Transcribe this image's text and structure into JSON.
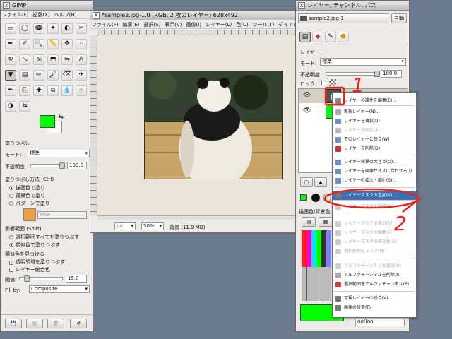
{
  "toolbox": {
    "title": "GIMP",
    "menu": [
      "ファイル(F)",
      "拡張(X)",
      "ヘルプ(H)"
    ],
    "tools_icons": [
      "rect-select-icon",
      "ellipse-select-icon",
      "free-select-icon",
      "fuzzy-select-icon",
      "color-select-icon",
      "scissors-icon",
      "paths-icon",
      "color-picker-icon",
      "zoom-icon",
      "measure-icon",
      "move-icon",
      "crop-icon",
      "rotate-icon",
      "scale-icon",
      "shear-icon",
      "perspective-icon",
      "flip-icon",
      "text-icon",
      "bucket-fill-icon",
      "blend-icon",
      "pencil-icon",
      "paintbrush-icon",
      "eraser-icon",
      "airbrush-icon",
      "ink-icon",
      "clone-icon",
      "heal-icon",
      "perspective-clone-icon",
      "blur-icon",
      "smudge-icon",
      "dodge-burn-icon",
      "color-swap-icon"
    ],
    "fg_color": "#00ff00",
    "bg_color": "#ffffff",
    "options_title": "塗りつぶし",
    "mode_label": "モード:",
    "mode_value": "標準",
    "opacity_label": "不透明度",
    "opacity_value": "100.0",
    "fill_type_label": "塗りつぶし方法 (Ctrl)",
    "fill_types": [
      "描画色で塗り",
      "背景色で塗り",
      "パターンで塗り"
    ],
    "pattern_name": "Pine",
    "affected_label": "影響範囲 (Shift)",
    "affected": [
      "選択範囲すべてを塗りつぶす",
      "類似色で塗りつぶす"
    ],
    "similar_label": "類似色を見つける",
    "transparent_label": "透明領域を塗りつぶす",
    "merged_label": "レイヤー統合色",
    "threshold_label": "閾値:",
    "threshold_value": "15.0",
    "fillby_label": "Fill by:",
    "fillby_value": "Composite"
  },
  "image_window": {
    "title": "*sample2.jpg-1.0 (RGB, 2 枚のレイヤー) 628x492",
    "menu": [
      "ファイル(F)",
      "編集(E)",
      "選択(S)",
      "表示(V)",
      "画像(I)",
      "レイヤー(L)",
      "色(C)",
      "ツール(T)",
      "ダイアロ"
    ],
    "unit": "px",
    "zoom": "50%",
    "status": "背景 (11.9 MB)"
  },
  "layers_window": {
    "title": "レイヤー, チャンネル, パス",
    "image_name": "sample2.jpg-1",
    "auto_label": "自動",
    "tab_label": "レイヤー",
    "mode_label": "モード:",
    "mode_value": "標準",
    "opacity_label": "不透明度",
    "opacity_value": "100.0",
    "lock_label": "ロック:",
    "palette_label": "描画色/背景色",
    "hex_value": "00ff00"
  },
  "context_menu": {
    "items": [
      {
        "label": "レイヤーの属性を編集(E)...",
        "disabled": false,
        "icon": "edit-icon"
      },
      {
        "label": "新規レイヤー(N)...",
        "disabled": false,
        "icon": "new-layer-icon"
      },
      {
        "label": "レイヤーを複製(U)",
        "disabled": false,
        "icon": "duplicate-icon"
      },
      {
        "label": "レイヤーを固定(A)",
        "disabled": true,
        "icon": "anchor-icon"
      },
      {
        "label": "下のレイヤーと統合(W)",
        "disabled": false,
        "icon": "merge-down-icon"
      },
      {
        "label": "レイヤーを削除(D)",
        "disabled": false,
        "icon": "delete-icon"
      },
      {
        "label": "レイヤー境界の大きさ(O)...",
        "disabled": false,
        "icon": "boundary-icon"
      },
      {
        "label": "レイヤーを画像サイズに合わせる(I)",
        "disabled": false,
        "icon": "fit-icon"
      },
      {
        "label": "レイヤーの拡大・縮小(S)...",
        "disabled": false,
        "icon": "scale-icon"
      },
      {
        "label": "レイヤーマスクの追加(Y)...",
        "disabled": false,
        "highlight": true,
        "icon": "mask-icon"
      },
      {
        "label": "レイヤーマスクを削除(E)",
        "disabled": true,
        "icon": "mask-delete-icon"
      },
      {
        "label": "レイヤーマスクの表示(S)",
        "disabled": true,
        "icon": "mask-show-icon"
      },
      {
        "label": "レイヤーマスクの編集(E)",
        "disabled": true,
        "icon": "mask-edit-icon"
      },
      {
        "label": "レイヤーマスクの無効化(D)",
        "disabled": true,
        "icon": "mask-disable-icon"
      },
      {
        "label": "選択範囲をマスク(M)",
        "disabled": true,
        "icon": "mask-select-icon"
      },
      {
        "label": "アルファチャンネルを追加(H)",
        "disabled": true,
        "icon": "alpha-add-icon"
      },
      {
        "label": "アルファチャンネルを削除(R)",
        "disabled": false,
        "icon": "alpha-remove-icon"
      },
      {
        "label": "選択範囲をアルファチャンネル(P)",
        "disabled": false,
        "icon": "alpha-select-icon"
      },
      {
        "label": "可視レイヤーの統合(V)...",
        "disabled": false,
        "icon": "merge-visible-icon"
      },
      {
        "label": "画像の統合(F)",
        "disabled": false,
        "icon": "flatten-icon"
      }
    ]
  },
  "annotations": {
    "one": "1",
    "two": "2"
  },
  "colors": {
    "annotation_red": "#e8241c",
    "highlight": "#3c6fb7",
    "fg_green": "#00ff00"
  }
}
